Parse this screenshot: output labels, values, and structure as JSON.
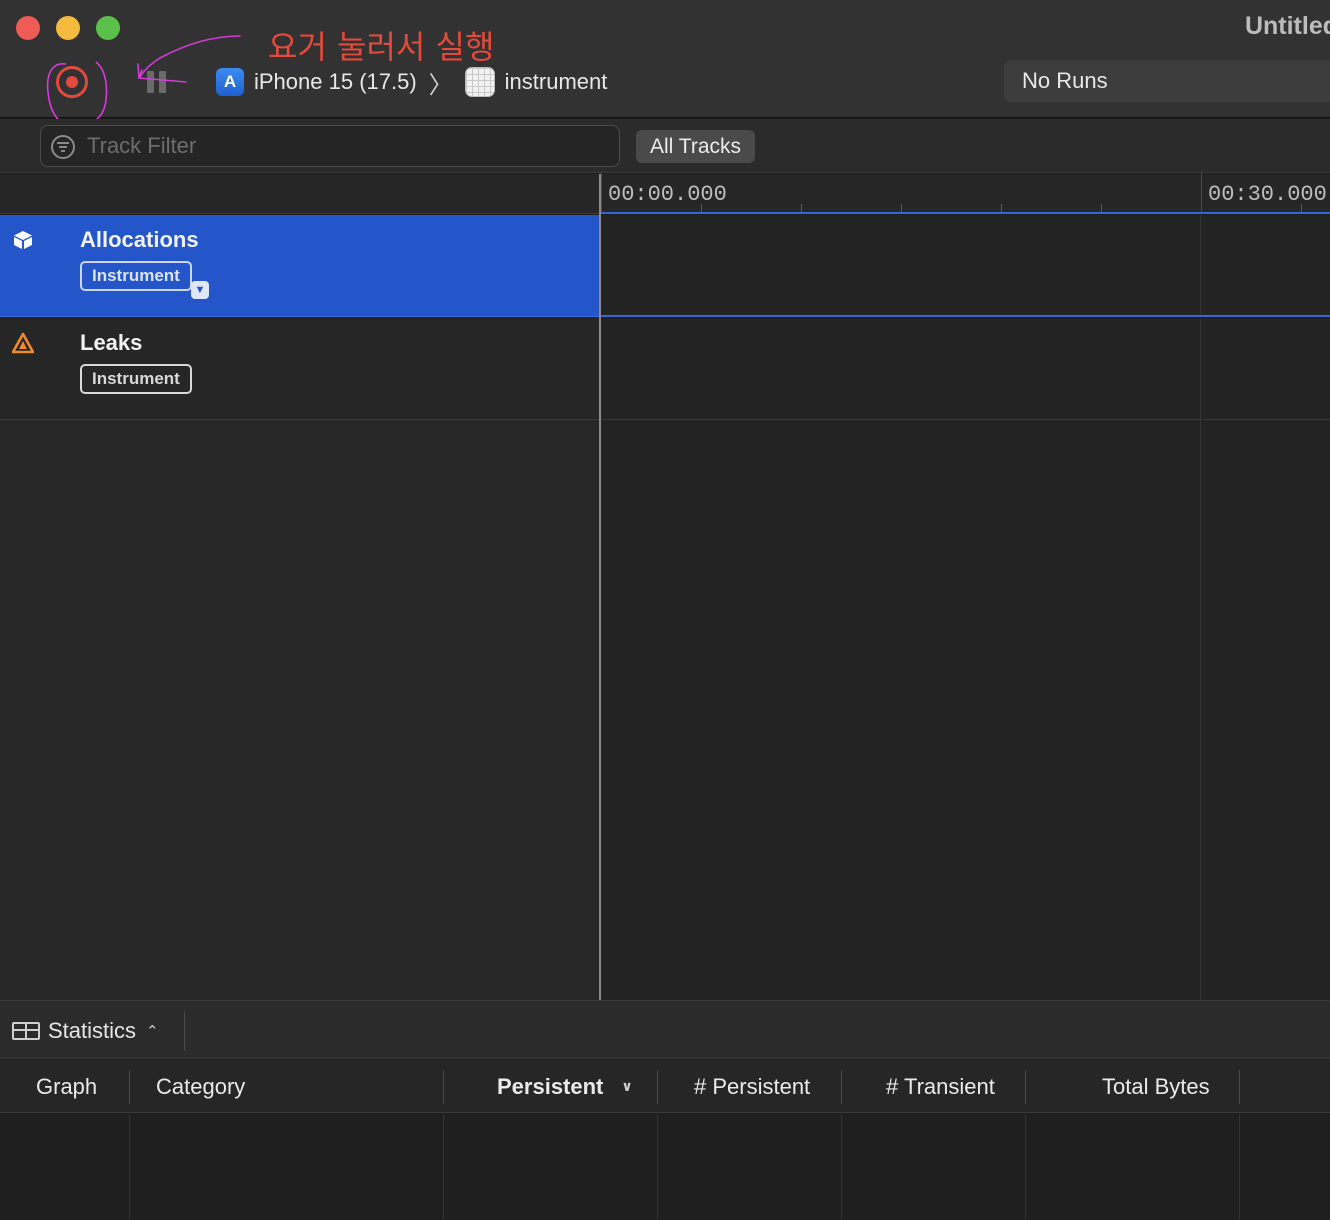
{
  "window": {
    "title": "Untitled"
  },
  "annotation": {
    "text": "요거 눌러서 실행"
  },
  "toolbar": {
    "device": "iPhone 15 (17.5)",
    "separator": "〉",
    "target": "instrument",
    "runs": "No Runs"
  },
  "filter": {
    "placeholder": "Track Filter",
    "scope_button": "All Tracks"
  },
  "timeline": {
    "ticks": [
      "00:00.000",
      "00:30.000"
    ]
  },
  "tracks": [
    {
      "name": "Allocations",
      "badge": "Instrument",
      "icon": "cube-icon",
      "selected": true
    },
    {
      "name": "Leaks",
      "badge": "Instrument",
      "icon": "warning-icon",
      "selected": false
    }
  ],
  "detail": {
    "view_selector": "Statistics",
    "columns": [
      "Graph",
      "Category",
      "Persistent",
      "# Persistent",
      "# Transient",
      "Total Bytes"
    ],
    "sorted_column": "Persistent"
  },
  "colors": {
    "record": "#e24a3e",
    "selection": "#2456c9",
    "annotation_ink": "#d63ad8",
    "annotation_text": "#e34a3c"
  }
}
